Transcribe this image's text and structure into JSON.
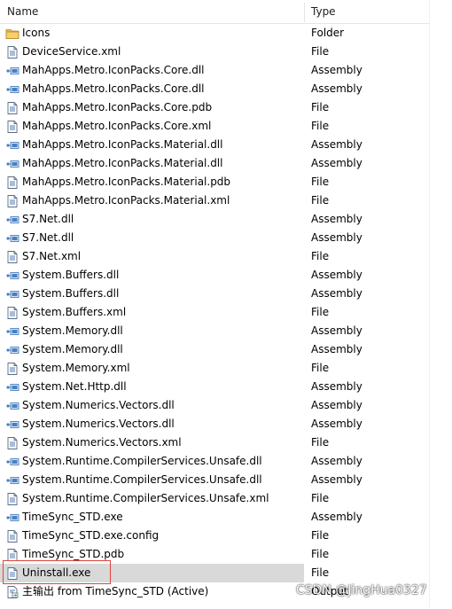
{
  "columns": {
    "name": "Name",
    "type": "Type"
  },
  "rows": [
    {
      "name": "Icons",
      "type": "Folder",
      "icon": "folder-icon"
    },
    {
      "name": "DeviceService.xml",
      "type": "File",
      "icon": "file-icon"
    },
    {
      "name": "MahApps.Metro.IconPacks.Core.dll",
      "type": "Assembly",
      "icon": "assembly-icon"
    },
    {
      "name": "MahApps.Metro.IconPacks.Core.dll",
      "type": "Assembly",
      "icon": "assembly-icon"
    },
    {
      "name": "MahApps.Metro.IconPacks.Core.pdb",
      "type": "File",
      "icon": "file-icon"
    },
    {
      "name": "MahApps.Metro.IconPacks.Core.xml",
      "type": "File",
      "icon": "file-icon"
    },
    {
      "name": "MahApps.Metro.IconPacks.Material.dll",
      "type": "Assembly",
      "icon": "assembly-icon"
    },
    {
      "name": "MahApps.Metro.IconPacks.Material.dll",
      "type": "Assembly",
      "icon": "assembly-icon"
    },
    {
      "name": "MahApps.Metro.IconPacks.Material.pdb",
      "type": "File",
      "icon": "file-icon"
    },
    {
      "name": "MahApps.Metro.IconPacks.Material.xml",
      "type": "File",
      "icon": "file-icon"
    },
    {
      "name": "S7.Net.dll",
      "type": "Assembly",
      "icon": "assembly-icon"
    },
    {
      "name": "S7.Net.dll",
      "type": "Assembly",
      "icon": "assembly-icon"
    },
    {
      "name": "S7.Net.xml",
      "type": "File",
      "icon": "file-icon"
    },
    {
      "name": "System.Buffers.dll",
      "type": "Assembly",
      "icon": "assembly-icon"
    },
    {
      "name": "System.Buffers.dll",
      "type": "Assembly",
      "icon": "assembly-icon"
    },
    {
      "name": "System.Buffers.xml",
      "type": "File",
      "icon": "file-icon"
    },
    {
      "name": "System.Memory.dll",
      "type": "Assembly",
      "icon": "assembly-icon"
    },
    {
      "name": "System.Memory.dll",
      "type": "Assembly",
      "icon": "assembly-icon"
    },
    {
      "name": "System.Memory.xml",
      "type": "File",
      "icon": "file-icon"
    },
    {
      "name": "System.Net.Http.dll",
      "type": "Assembly",
      "icon": "assembly-icon"
    },
    {
      "name": "System.Numerics.Vectors.dll",
      "type": "Assembly",
      "icon": "assembly-icon"
    },
    {
      "name": "System.Numerics.Vectors.dll",
      "type": "Assembly",
      "icon": "assembly-icon"
    },
    {
      "name": "System.Numerics.Vectors.xml",
      "type": "File",
      "icon": "file-icon"
    },
    {
      "name": "System.Runtime.CompilerServices.Unsafe.dll",
      "type": "Assembly",
      "icon": "assembly-icon"
    },
    {
      "name": "System.Runtime.CompilerServices.Unsafe.dll",
      "type": "Assembly",
      "icon": "assembly-icon"
    },
    {
      "name": "System.Runtime.CompilerServices.Unsafe.xml",
      "type": "File",
      "icon": "file-icon"
    },
    {
      "name": "TimeSync_STD.exe",
      "type": "Assembly",
      "icon": "assembly-icon"
    },
    {
      "name": "TimeSync_STD.exe.config",
      "type": "File",
      "icon": "file-icon"
    },
    {
      "name": "TimeSync_STD.pdb",
      "type": "File",
      "icon": "file-icon"
    },
    {
      "name": "Uninstall.exe",
      "type": "File",
      "icon": "file-icon",
      "selected": true
    },
    {
      "name": "主输出 from TimeSync_STD (Active)",
      "type": "Output",
      "icon": "project-output-icon"
    }
  ],
  "watermark": "CSDN @JingHua0327",
  "colors": {
    "selected_row": "#d9d9d9",
    "highlight_box": "#e0453a",
    "folder": "#e8b84a",
    "assembly": "#4a7fc1"
  }
}
